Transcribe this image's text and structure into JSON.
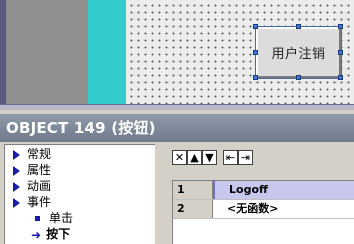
{
  "editor": {
    "button_label": "用户注销"
  },
  "panel": {
    "title": "OBJECT 149 (按钮)",
    "tree": [
      {
        "label": "常规",
        "icon": "triangle-icon"
      },
      {
        "label": "属性",
        "icon": "triangle-icon"
      },
      {
        "label": "动画",
        "icon": "triangle-icon"
      },
      {
        "label": "事件",
        "icon": "triangle-icon"
      },
      {
        "label": "单击",
        "icon": "square-bullet-icon"
      },
      {
        "label": "按下",
        "icon": "arrow-right-icon",
        "selected": true
      }
    ],
    "toolbar": {
      "delete": "✕",
      "move_up": "▲",
      "move_down": "▼",
      "indent_left": "⇤",
      "indent_right": "⇥"
    },
    "functions": [
      {
        "num": "1",
        "name": "Logoff",
        "selected": true
      },
      {
        "num": "2",
        "name": "<无函数>",
        "selected": false
      }
    ]
  },
  "colors": {
    "cyan_strip": "#33cccc",
    "selection_handle": "#3f78d0",
    "tree_bullet": "#1a1aa8",
    "row_selected": "#c8c8ee"
  }
}
